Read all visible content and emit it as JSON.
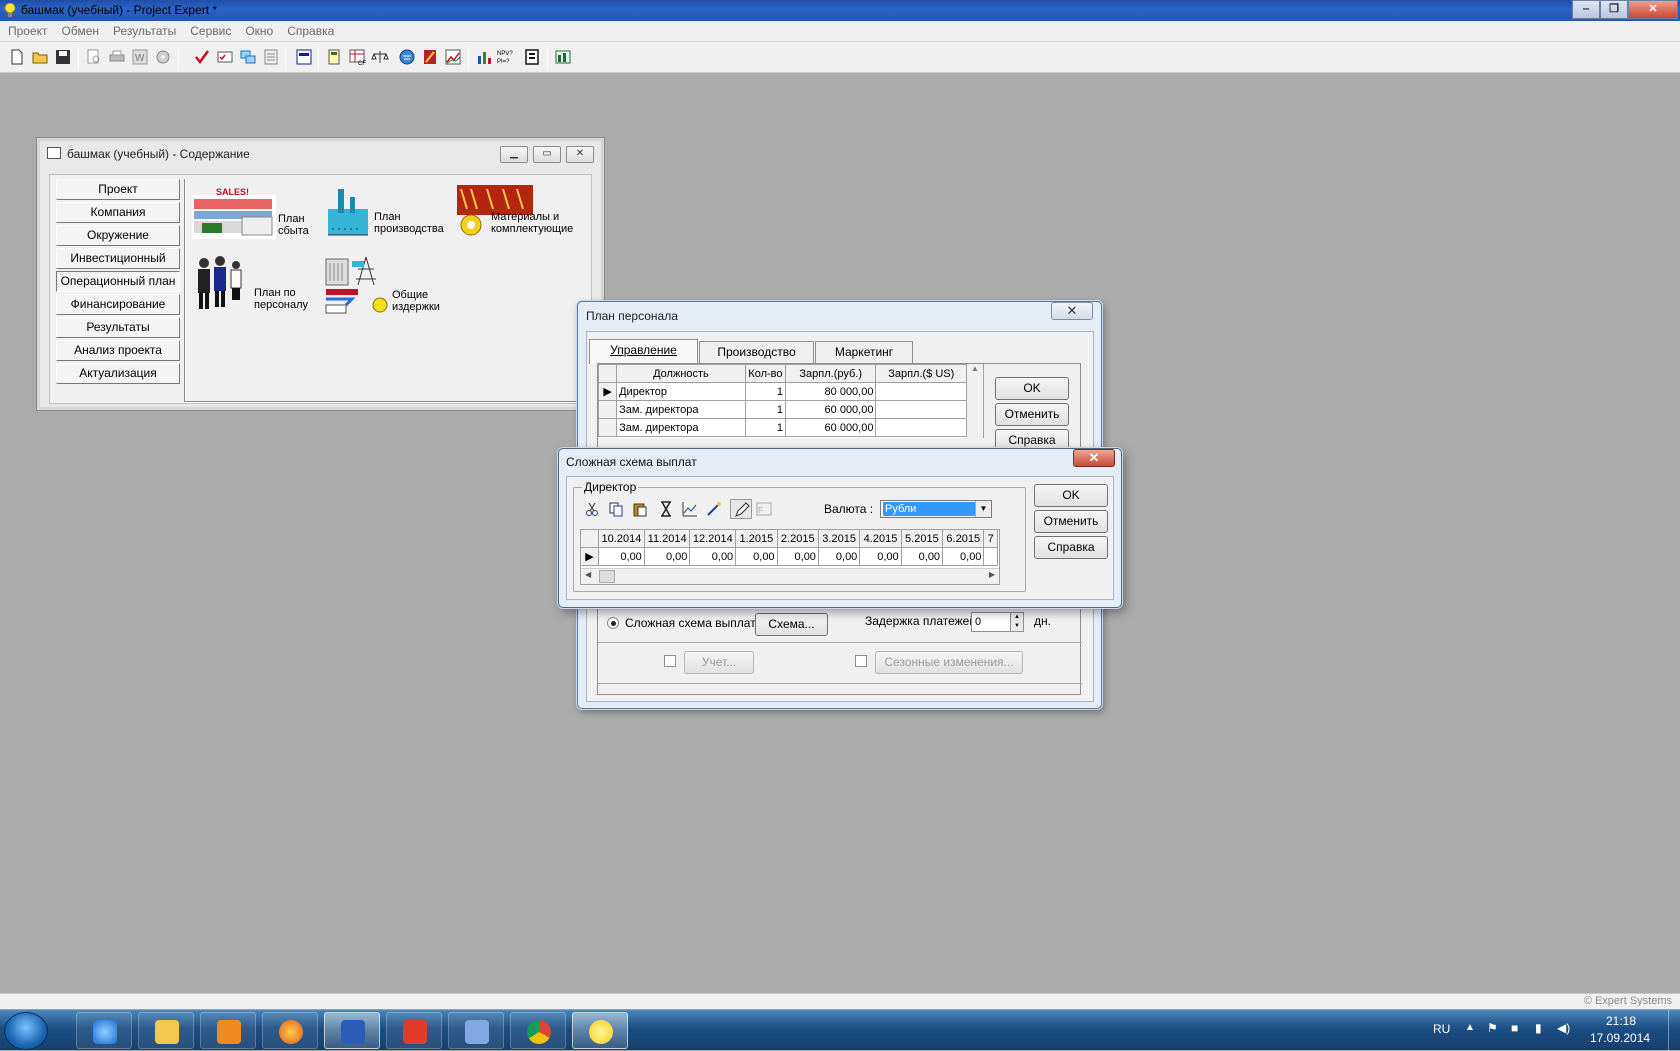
{
  "app": {
    "title": "башмак (учебный) - Project Expert *",
    "win_controls": {
      "min": "‒",
      "max": "❐",
      "close": "✕"
    }
  },
  "menu": [
    "Проект",
    "Обмен",
    "Результаты",
    "Сервис",
    "Окно",
    "Справка"
  ],
  "toolbar_icons": [
    "new-icon",
    "open-icon",
    "save-icon",
    "preview-icon",
    "print-icon",
    "word-export-icon",
    "settings-icon",
    "check-icon",
    "checklist-icon",
    "exchange-icon",
    "notes-icon",
    "table-icon",
    "calculator-icon",
    "cashflow-icon",
    "balance-icon",
    "globe-icon",
    "book-icon",
    "chart-icon",
    "bar-chart-icon",
    "npv-irr-icon",
    "stack-icon",
    "report-icon"
  ],
  "contents": {
    "title": "башмак (учебный) - Содержание",
    "nav": [
      "Проект",
      "Компания",
      "Окружение",
      "Инвестиционный план",
      "Операционный план",
      "Финансирование",
      "Результаты",
      "Анализ проекта",
      "Актуализация"
    ],
    "pressed_nav_index": 4,
    "modules": {
      "sales_word": "SALES!",
      "sales": [
        "План",
        "сбыта"
      ],
      "production": [
        "План",
        "производства"
      ],
      "materials": [
        "Материалы   и",
        "комплектующие"
      ],
      "personnel": [
        "План   по",
        "персоналу"
      ],
      "overhead": [
        "Общие",
        "издержки"
      ]
    }
  },
  "staff": {
    "title": "План персонала",
    "tabs": [
      "Управление",
      "Производство",
      "Маркетинг"
    ],
    "columns": [
      "Должность",
      "Кол-во",
      "Зарпл.(руб.)",
      "Зарпл.($ US)"
    ],
    "rows": [
      {
        "name": "Директор",
        "qty": "1",
        "rub": "80 000,00",
        "usd": ""
      },
      {
        "name": "Зам. директора",
        "qty": "1",
        "rub": "60 000,00",
        "usd": ""
      },
      {
        "name": "Зам. директора",
        "qty": "1",
        "rub": "60 000,00",
        "usd": ""
      }
    ],
    "buttons": {
      "ok": "OK",
      "cancel": "Отменить",
      "help": "Справка"
    },
    "complex_scheme_label": "Сложная схема выплат",
    "scheme_button": "Схема...",
    "delay_label": "Задержка платежей:",
    "delay_value": "0",
    "delay_unit": "дн.",
    "account_button": "Учет...",
    "seasonal_button": "Сезонные изменения..."
  },
  "complex": {
    "title": "Сложная схема выплат",
    "group_label": "Директор",
    "currency_label": "Валюта :",
    "currency_value": "Рубли",
    "periods": [
      "10.2014",
      "11.2014",
      "12.2014",
      "1.2015",
      "2.2015",
      "3.2015",
      "4.2015",
      "5.2015",
      "6.2015",
      "7"
    ],
    "values": [
      "0,00",
      "0,00",
      "0,00",
      "0,00",
      "0,00",
      "0,00",
      "0,00",
      "0,00",
      "0,00"
    ],
    "buttons": {
      "ok": "OK",
      "cancel": "Отменить",
      "help": "Справка"
    }
  },
  "status": {
    "copyright": "© Expert Systems"
  },
  "taskbar": {
    "apps": [
      "ie-icon",
      "explorer-icon",
      "media-player-icon",
      "firefox-icon",
      "word-icon",
      "yandex-icon",
      "speaker-app-icon",
      "chrome-icon",
      "project-expert-icon"
    ],
    "lang": "RU",
    "time": "21:18",
    "date": "17.09.2014"
  }
}
